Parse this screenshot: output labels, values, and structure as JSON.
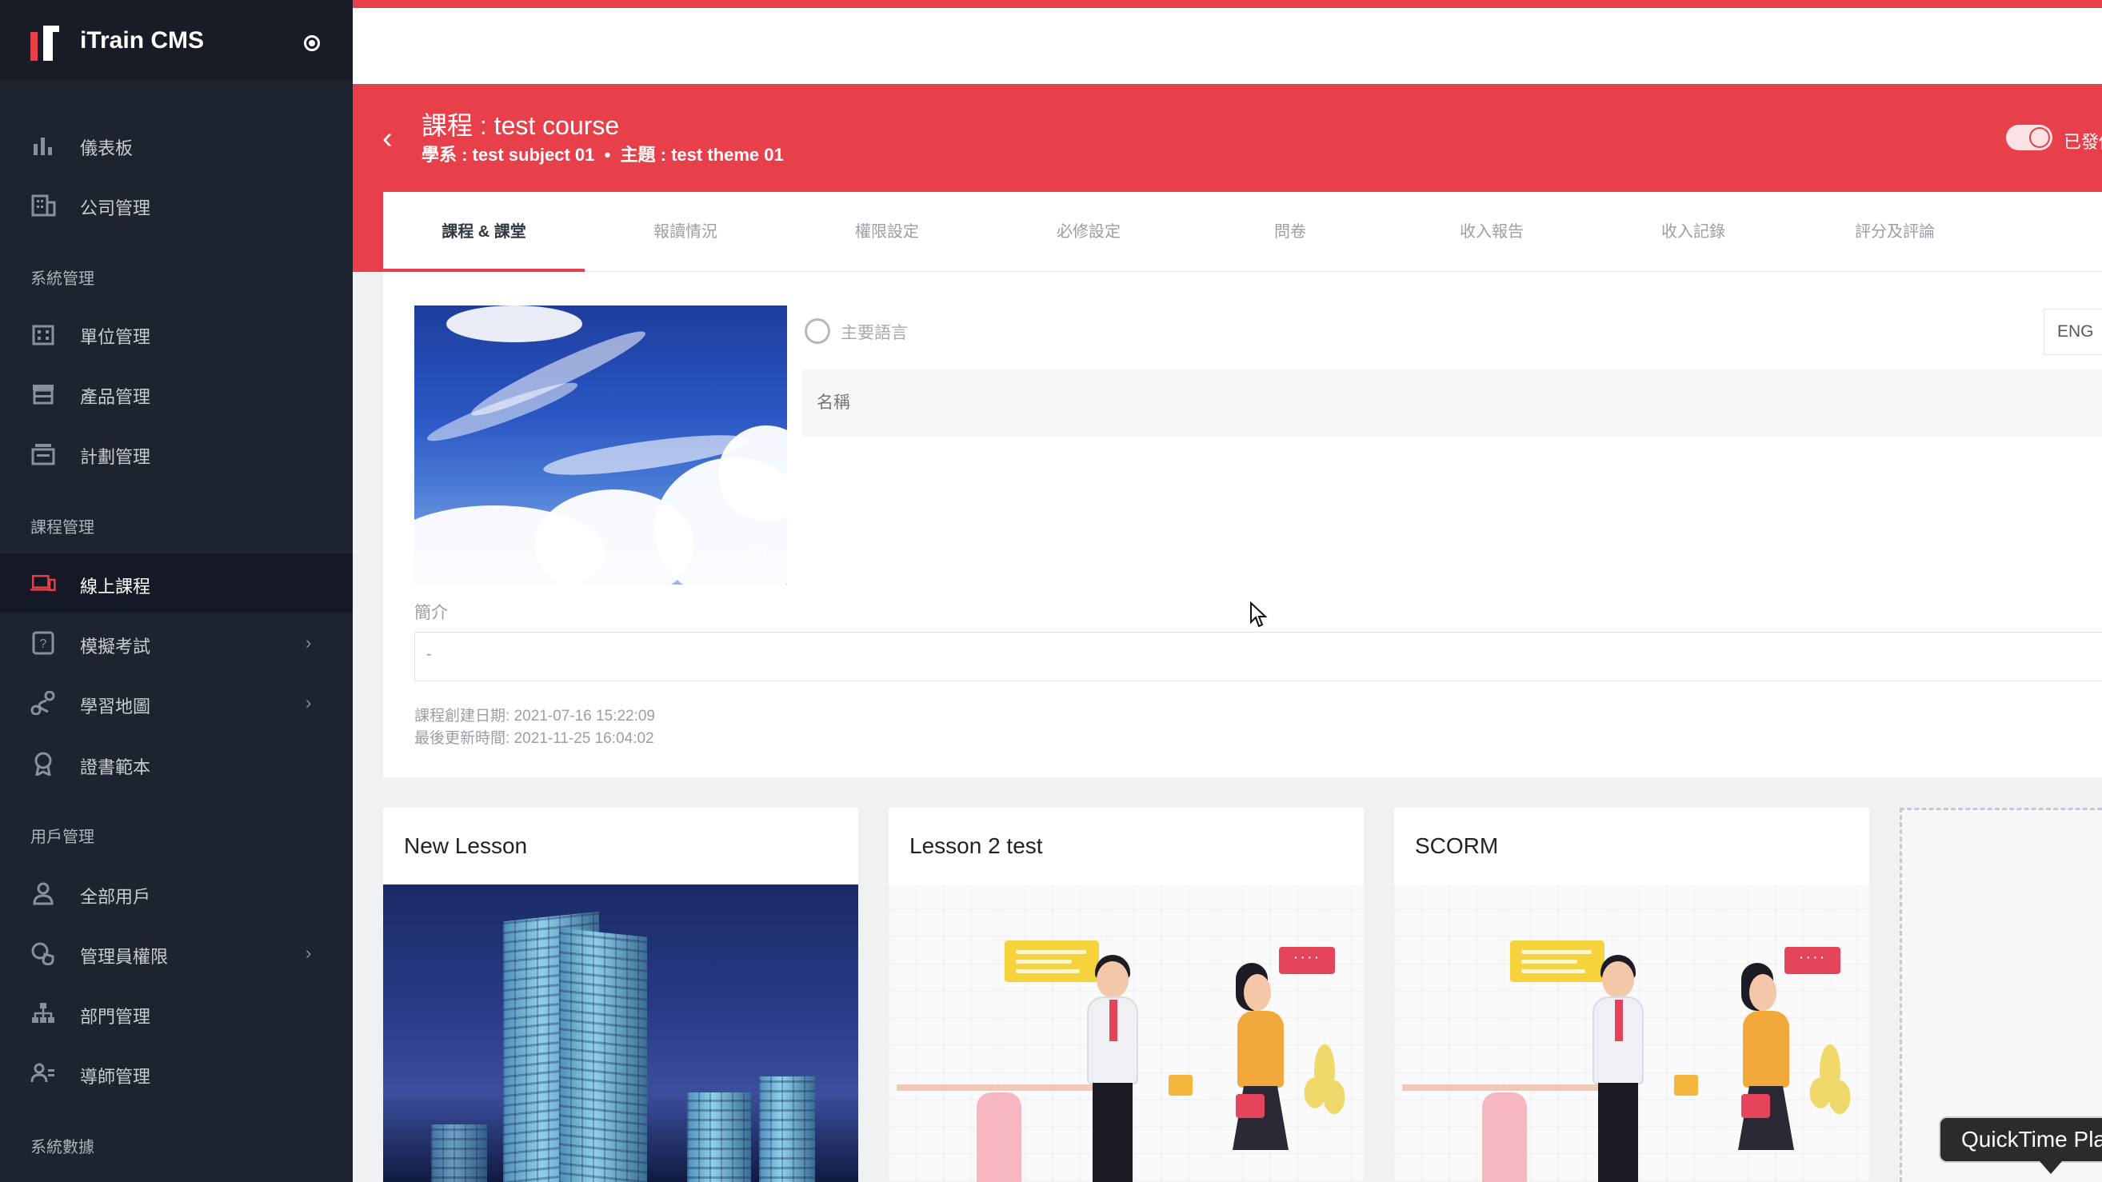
{
  "app": {
    "title": "iTrain CMS"
  },
  "sidebar": {
    "items_top": [
      {
        "label": "儀表板",
        "icon": "bar-chart-icon"
      },
      {
        "label": "公司管理",
        "icon": "building-icon"
      }
    ],
    "sections": [
      {
        "label": "系統管理",
        "items": [
          {
            "label": "單位管理",
            "icon": "office-icon"
          },
          {
            "label": "產品管理",
            "icon": "store-icon"
          },
          {
            "label": "計劃管理",
            "icon": "plan-icon"
          }
        ]
      },
      {
        "label": "課程管理",
        "items": [
          {
            "label": "線上課程",
            "icon": "laptop-icon",
            "active": true
          },
          {
            "label": "模擬考試",
            "icon": "quiz-icon",
            "chevron": true
          },
          {
            "label": "學習地圖",
            "icon": "route-icon",
            "chevron": true
          },
          {
            "label": "證書範本",
            "icon": "award-icon"
          }
        ]
      },
      {
        "label": "用戶管理",
        "items": [
          {
            "label": "全部用戶",
            "icon": "user-icon"
          },
          {
            "label": "管理員權限",
            "icon": "admin-shield-icon",
            "chevron": true
          },
          {
            "label": "部門管理",
            "icon": "org-chart-icon"
          },
          {
            "label": "導師管理",
            "icon": "teacher-icon"
          }
        ]
      },
      {
        "label": "系統數據",
        "items": []
      }
    ],
    "chevron": "›"
  },
  "header": {
    "back": "‹",
    "course_title": "課程 : test course",
    "subtitle": "學系 : test subject 01  •  主題 : test theme 01",
    "publish_label": "已發佈",
    "published": true
  },
  "tabs": [
    {
      "label": "課程 & 課堂",
      "active": true
    },
    {
      "label": "報讀情況"
    },
    {
      "label": "權限設定"
    },
    {
      "label": "必修設定"
    },
    {
      "label": "問卷"
    },
    {
      "label": "收入報告"
    },
    {
      "label": "收入記錄"
    },
    {
      "label": "評分及評論"
    }
  ],
  "course_form": {
    "primary_lang_label": "主要語言",
    "lang_button": "ENG",
    "name_placeholder": "名稱",
    "intro_label": "簡介",
    "intro_value": "-",
    "created": "課程創建日期: 2021-07-16 15:22:09",
    "updated": "最後更新時間: 2021-11-25 16:04:02",
    "expand_icon": "⛶"
  },
  "lessons": [
    {
      "title": "New Lesson",
      "thumb": "city-building"
    },
    {
      "title": "Lesson 2 test",
      "thumb": "handshake-meeting"
    },
    {
      "title": "SCORM",
      "thumb": "handshake-meeting"
    }
  ],
  "quicktime_tooltip": "QuickTime Player",
  "colors": {
    "accent": "#e8404a",
    "sidebar_bg": "#1e2330",
    "sidebar_active": "#151925"
  }
}
